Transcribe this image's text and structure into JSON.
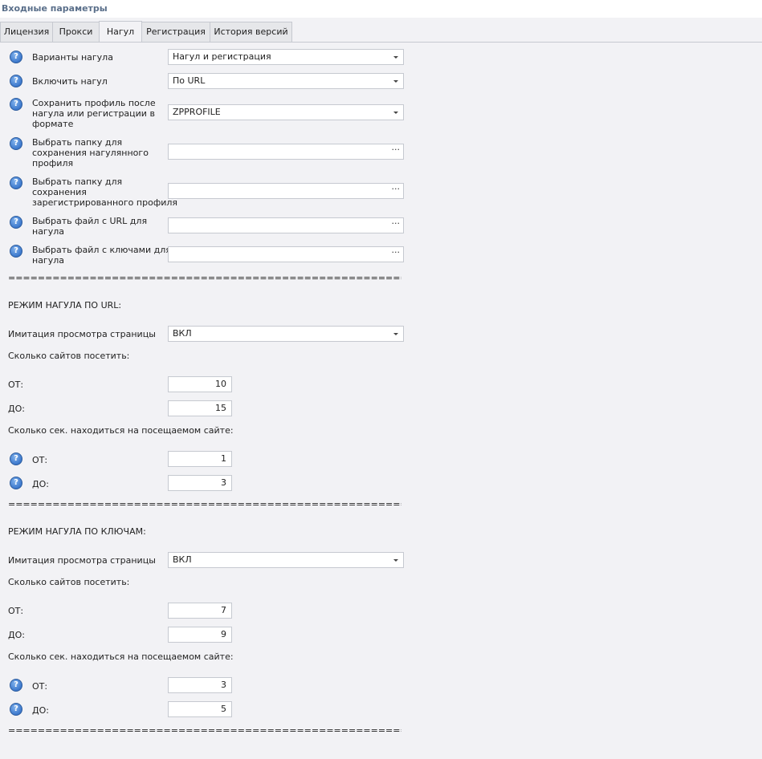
{
  "window": {
    "title": "Входные параметры"
  },
  "tabs": [
    "Лицензия",
    "Прокси",
    "Нагул",
    "Регистрация",
    "История версий"
  ],
  "general": {
    "variants_label": "Варианты нагула",
    "variants_value": "Нагул и регистрация",
    "enable_label": "Включить нагул",
    "enable_value": "По URL",
    "save_profile_label": [
      "Сохранить профиль после",
      "нагула или регистрации в",
      "формате"
    ],
    "save_profile_value": "ZPPROFILE",
    "folder_nagul_label": [
      "Выбрать папку для",
      "сохранения нагулянного",
      "профиля"
    ],
    "folder_reg_label": [
      "Выбрать папку для",
      "сохранения",
      "зарегистрированного профиля"
    ],
    "url_file_label": [
      "Выбрать файл с URL для",
      "нагула"
    ],
    "keys_file_label": [
      "Выбрать файл с ключами для",
      "нагула"
    ],
    "browse_dots": "···"
  },
  "separator": "===========================================================",
  "url_mode": {
    "header": "РЕЖИМ НАГУЛА ПО URL:",
    "imitation_label": "Имитация просмотра страницы",
    "imitation_value": "ВКЛ",
    "sites_label": "Сколько сайтов посетить:",
    "sites_from_label": "ОТ:",
    "sites_from": "10",
    "sites_to_label": "ДО:",
    "sites_to": "15",
    "secs_label": "Сколько сек. находиться на посещаемом сайте:",
    "secs_from_label": "ОТ:",
    "secs_from": "1",
    "secs_to_label": "ДО:",
    "secs_to": "3"
  },
  "keys_mode": {
    "header": "РЕЖИМ НАГУЛА ПО КЛЮЧАМ:",
    "imitation_label": "Имитация просмотра страницы",
    "imitation_value": "ВКЛ",
    "sites_label": "Сколько сайтов посетить:",
    "sites_from_label": "ОТ:",
    "sites_from": "7",
    "sites_to_label": "ДО:",
    "sites_to": "9",
    "secs_label": "Сколько сек. находиться на посещаемом сайте:",
    "secs_from_label": "ОТ:",
    "secs_from": "3",
    "secs_to_label": "ДО:",
    "secs_to": "5"
  },
  "icons": {
    "help": "help-question-icon",
    "dropdown": "chevron-down-icon",
    "help_glyph": "?"
  },
  "colors": {
    "accent": "#3c78cc",
    "background": "#f2f2f5",
    "title": "#5a6f8a"
  }
}
